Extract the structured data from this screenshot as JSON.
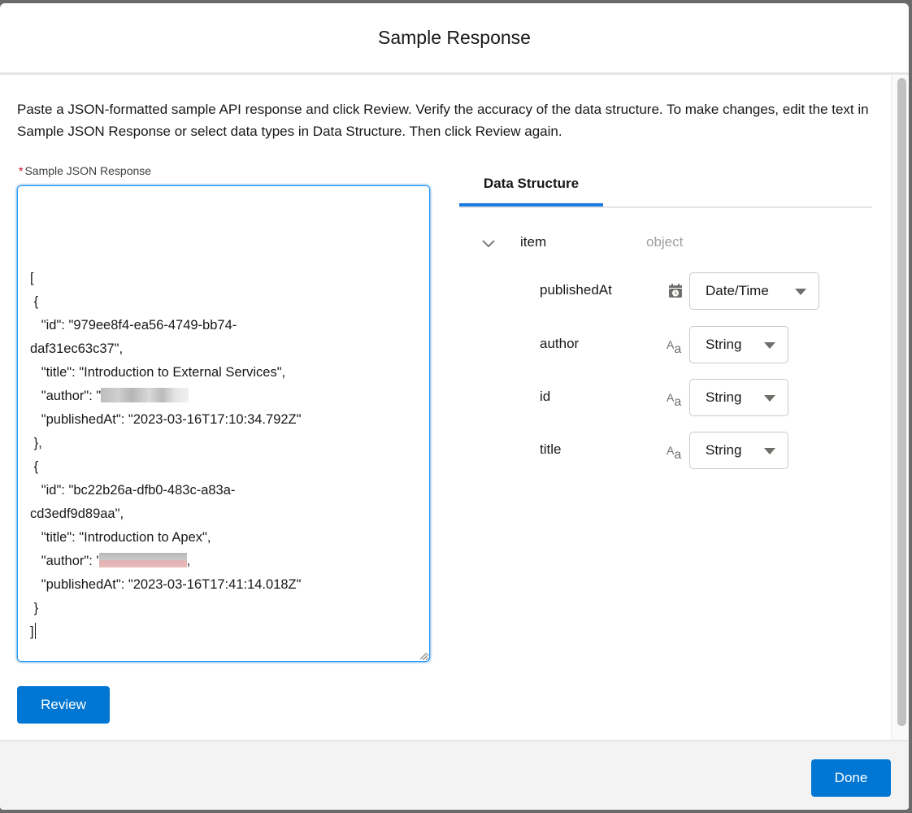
{
  "modal": {
    "title": "Sample Response"
  },
  "intro": {
    "text": "Paste a JSON-formatted sample API response and click Review. Verify the accuracy of the data structure. To make changes, edit the text in Sample JSON Response or select data types in Data Structure. Then click Review again."
  },
  "json_field": {
    "required_marker": "*",
    "label": "Sample JSON Response",
    "lines": [
      {
        "text": "["
      },
      {
        "text": " {"
      },
      {
        "text": "   \"id\": \"979ee8f4-ea56-4749-bb74-"
      },
      {
        "text": "daf31ec63c37\","
      },
      {
        "text": "   \"title\": \"Introduction to External Services\","
      },
      {
        "text": "   \"author\": \"",
        "redacted": true,
        "redacted_style": "gray"
      },
      {
        "text": "   \"publishedAt\": \"2023-03-16T17:10:34.792Z\""
      },
      {
        "text": " },"
      },
      {
        "text": " {"
      },
      {
        "text": "   \"id\": \"bc22b26a-dfb0-483c-a83a-"
      },
      {
        "text": "cd3edf9d89aa\","
      },
      {
        "text": "   \"title\": \"Introduction to Apex\","
      },
      {
        "text": "   \"author\": '",
        "redacted": true,
        "redacted_style": "pink",
        "suffix": ","
      },
      {
        "text": "   \"publishedAt\": \"2023-03-16T17:41:14.018Z\""
      },
      {
        "text": " }"
      },
      {
        "text": "]",
        "caret": true
      }
    ]
  },
  "buttons": {
    "review": "Review",
    "done": "Done"
  },
  "data_structure": {
    "tab_label": "Data Structure",
    "root": {
      "name": "item",
      "type": "object",
      "expanded": true,
      "icon": "chevron-down-icon"
    },
    "fields": [
      {
        "name": "publishedAt",
        "icon": "calendar-clock-icon",
        "type": "Date/Time"
      },
      {
        "name": "author",
        "icon": "text-aa-icon",
        "type": "String"
      },
      {
        "name": "id",
        "icon": "text-aa-icon",
        "type": "String"
      },
      {
        "name": "title",
        "icon": "text-aa-icon",
        "type": "String"
      }
    ]
  },
  "colors": {
    "brand_blue": "#0176d3",
    "tab_underline": "#1b7be0",
    "focus_border": "#1b96ff",
    "required_red": "#ba0517"
  }
}
